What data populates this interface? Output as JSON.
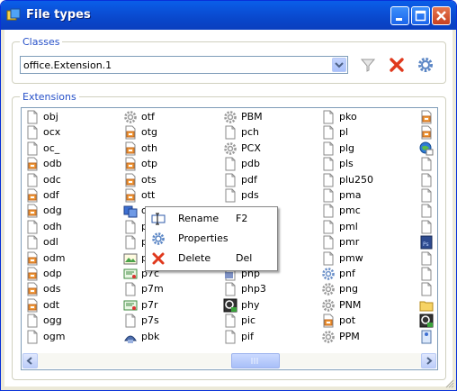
{
  "window": {
    "title": "File types"
  },
  "classes": {
    "group_label": "Classes",
    "selected_class": "office.Extension.1"
  },
  "extensions": {
    "group_label": "Extensions",
    "columns": [
      [
        {
          "label": "obj",
          "icon": "generic-file"
        },
        {
          "label": "ocx",
          "icon": "generic-file"
        },
        {
          "label": "oc_",
          "icon": "generic-file"
        },
        {
          "label": "odb",
          "icon": "openoffice-file"
        },
        {
          "label": "odc",
          "icon": "generic-file"
        },
        {
          "label": "odf",
          "icon": "openoffice-file"
        },
        {
          "label": "odg",
          "icon": "openoffice-file"
        },
        {
          "label": "odh",
          "icon": "generic-file"
        },
        {
          "label": "odl",
          "icon": "generic-file"
        },
        {
          "label": "odm",
          "icon": "openoffice-file"
        },
        {
          "label": "odp",
          "icon": "openoffice-file"
        },
        {
          "label": "ods",
          "icon": "openoffice-file"
        },
        {
          "label": "odt",
          "icon": "openoffice-file"
        },
        {
          "label": "ogg",
          "icon": "generic-file"
        },
        {
          "label": "ogm",
          "icon": "generic-file"
        }
      ],
      [
        {
          "label": "otf",
          "icon": "gear-file"
        },
        {
          "label": "otg",
          "icon": "openoffice-file"
        },
        {
          "label": "oth",
          "icon": "openoffice-file"
        },
        {
          "label": "otp",
          "icon": "openoffice-file"
        },
        {
          "label": "ots",
          "icon": "openoffice-file"
        },
        {
          "label": "ott",
          "icon": "openoffice-file"
        },
        {
          "label": "o",
          "icon": "blue-tile"
        },
        {
          "label": "p",
          "icon": "generic-file"
        },
        {
          "label": "p",
          "icon": "generic-file"
        },
        {
          "label": "p",
          "icon": "image-file"
        },
        {
          "label": "p7c",
          "icon": "cert-file"
        },
        {
          "label": "p7m",
          "icon": "generic-file"
        },
        {
          "label": "p7r",
          "icon": "cert-file"
        },
        {
          "label": "p7s",
          "icon": "generic-file"
        },
        {
          "label": "pbk",
          "icon": "phone-file"
        }
      ],
      [
        {
          "label": "PBM",
          "icon": "gear-file"
        },
        {
          "label": "pch",
          "icon": "generic-file"
        },
        {
          "label": "PCX",
          "icon": "gear-file"
        },
        {
          "label": "pdb",
          "icon": "generic-file"
        },
        {
          "label": "pdf",
          "icon": "generic-file"
        },
        {
          "label": "pds",
          "icon": "generic-file"
        },
        {
          "label": "",
          "icon": "none"
        },
        {
          "label": "",
          "icon": "none"
        },
        {
          "label": "",
          "icon": "none"
        },
        {
          "label": "",
          "icon": "none"
        },
        {
          "label": "php",
          "icon": "php-file"
        },
        {
          "label": "php3",
          "icon": "generic-file"
        },
        {
          "label": "phy",
          "icon": "phy-file"
        },
        {
          "label": "pic",
          "icon": "generic-file"
        },
        {
          "label": "pif",
          "icon": "generic-file"
        }
      ],
      [
        {
          "label": "pko",
          "icon": "generic-file"
        },
        {
          "label": "pl",
          "icon": "generic-file"
        },
        {
          "label": "plg",
          "icon": "generic-file"
        },
        {
          "label": "pls",
          "icon": "generic-file"
        },
        {
          "label": "plu250",
          "icon": "generic-file"
        },
        {
          "label": "pma",
          "icon": "generic-file"
        },
        {
          "label": "pmc",
          "icon": "generic-file"
        },
        {
          "label": "pml",
          "icon": "generic-file"
        },
        {
          "label": "pmr",
          "icon": "generic-file"
        },
        {
          "label": "pmw",
          "icon": "generic-file"
        },
        {
          "label": "pnf",
          "icon": "gear-blue-file"
        },
        {
          "label": "png",
          "icon": "gear-file"
        },
        {
          "label": "PNM",
          "icon": "gear-file"
        },
        {
          "label": "pot",
          "icon": "openoffice-file"
        },
        {
          "label": "PPM",
          "icon": "gear-file"
        }
      ],
      [
        {
          "label": "",
          "icon": "openoffice-file"
        },
        {
          "label": "",
          "icon": "openoffice-file"
        },
        {
          "label": "",
          "icon": "globe-file"
        },
        {
          "label": "",
          "icon": "generic-file"
        },
        {
          "label": "",
          "icon": "generic-file"
        },
        {
          "label": "",
          "icon": "generic-file"
        },
        {
          "label": "",
          "icon": "generic-file"
        },
        {
          "label": "",
          "icon": "generic-file"
        },
        {
          "label": "",
          "icon": "photoshop-file"
        },
        {
          "label": "",
          "icon": "generic-file"
        },
        {
          "label": "",
          "icon": "generic-file"
        },
        {
          "label": "",
          "icon": "generic-file"
        },
        {
          "label": "",
          "icon": "folder-file"
        },
        {
          "label": "",
          "icon": "phy-file"
        },
        {
          "label": "",
          "icon": "blue-doc-file"
        }
      ]
    ]
  },
  "context_menu": {
    "items": [
      {
        "label": "Rename",
        "shortcut": "F2",
        "icon": "rename-icon"
      },
      {
        "label": "Properties",
        "shortcut": "",
        "icon": "gear-icon"
      },
      {
        "label": "Delete",
        "shortcut": "Del",
        "icon": "delete-icon"
      }
    ]
  },
  "colors": {
    "accent": "#2650c8",
    "title_bar": "#0a4fd6",
    "delete_red": "#e0391d"
  }
}
